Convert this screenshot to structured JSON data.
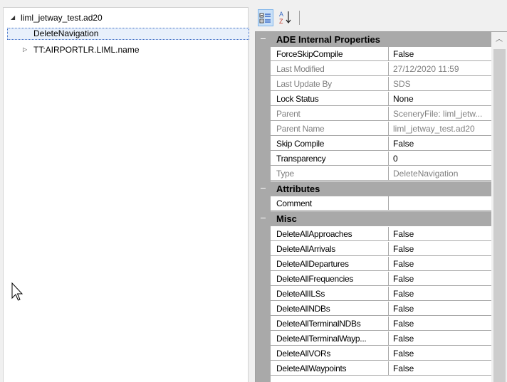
{
  "tree": {
    "root": {
      "label": "liml_jetway_test.ad20",
      "expanded": true
    },
    "children": [
      {
        "label": "DeleteNavigation",
        "selected": true
      },
      {
        "label": "TT:AIRPORTLR.LIML.name",
        "expanded": false
      }
    ]
  },
  "toolbar": {
    "categorized_icon": "categorized-view-icon",
    "alphabetical_icon": "alphabetical-sort-icon",
    "active": "categorized"
  },
  "property_grid": {
    "categories": [
      {
        "title": "ADE Internal Properties",
        "rows": [
          {
            "name": "ForceSkipCompile",
            "value": "False",
            "readonly": false
          },
          {
            "name": "Last Modified",
            "value": "27/12/2020 11:59",
            "readonly": true
          },
          {
            "name": "Last Update By",
            "value": "SDS",
            "readonly": true
          },
          {
            "name": "Lock Status",
            "value": "None",
            "readonly": false
          },
          {
            "name": "Parent",
            "value": "SceneryFile: liml_jetw...",
            "readonly": true
          },
          {
            "name": "Parent Name",
            "value": "liml_jetway_test.ad20",
            "readonly": true
          },
          {
            "name": "Skip Compile",
            "value": "False",
            "readonly": false
          },
          {
            "name": "Transparency",
            "value": "0",
            "readonly": false
          },
          {
            "name": "Type",
            "value": "DeleteNavigation",
            "readonly": true
          }
        ]
      },
      {
        "title": "Attributes",
        "rows": [
          {
            "name": "Comment",
            "value": "",
            "readonly": false
          }
        ]
      },
      {
        "title": "Misc",
        "rows": [
          {
            "name": "DeleteAllApproaches",
            "value": "False",
            "readonly": false
          },
          {
            "name": "DeleteAllArrivals",
            "value": "False",
            "readonly": false
          },
          {
            "name": "DeleteAllDepartures",
            "value": "False",
            "readonly": false
          },
          {
            "name": "DeleteAllFrequencies",
            "value": "False",
            "readonly": false
          },
          {
            "name": "DeleteAllILSs",
            "value": "False",
            "readonly": false
          },
          {
            "name": "DeleteAllNDBs",
            "value": "False",
            "readonly": false
          },
          {
            "name": "DeleteAllTerminalNDBs",
            "value": "False",
            "readonly": false
          },
          {
            "name": "DeleteAllTerminalWayp...",
            "value": "False",
            "readonly": false
          },
          {
            "name": "DeleteAllVORs",
            "value": "False",
            "readonly": false
          },
          {
            "name": "DeleteAllWaypoints",
            "value": "False",
            "readonly": false
          }
        ]
      }
    ]
  },
  "colors": {
    "category_band": "#a9a9a9",
    "readonly_text": "#808080",
    "selection_fill": "#e8f0fb",
    "toolbar_active": "#c9e0f7"
  }
}
